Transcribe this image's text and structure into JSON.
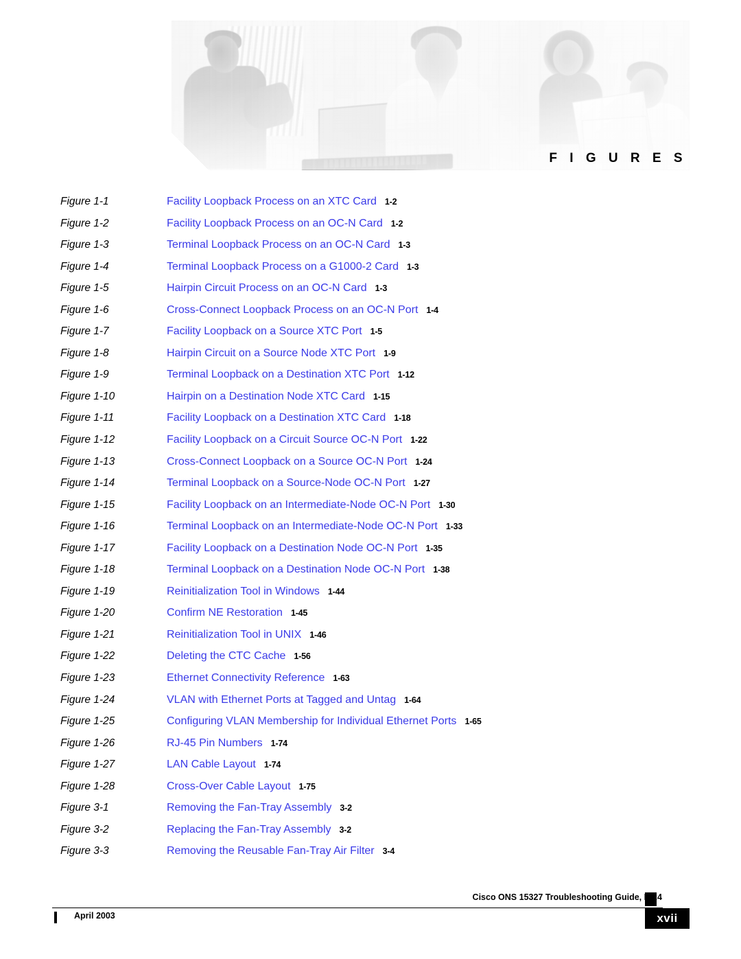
{
  "header": {
    "section_title": "F I G U R E S",
    "banner_icon": "people-collaborating-photo"
  },
  "figure_list": [
    {
      "label": "Figure 1-1",
      "title": "Facility Loopback Process on an XTC Card",
      "page": "1-2"
    },
    {
      "label": "Figure 1-2",
      "title": "Facility Loopback Process on an OC-N Card",
      "page": "1-2"
    },
    {
      "label": "Figure 1-3",
      "title": "Terminal Loopback Process on an OC-N Card",
      "page": "1-3"
    },
    {
      "label": "Figure 1-4",
      "title": "Terminal Loopback Process on a G1000-2 Card",
      "page": "1-3"
    },
    {
      "label": "Figure 1-5",
      "title": "Hairpin Circuit Process on an OC-N Card",
      "page": "1-3"
    },
    {
      "label": "Figure 1-6",
      "title": "Cross-Connect Loopback Process on an OC-N Port",
      "page": "1-4"
    },
    {
      "label": "Figure 1-7",
      "title": "Facility Loopback on a Source XTC Port",
      "page": "1-5"
    },
    {
      "label": "Figure 1-8",
      "title": "Hairpin Circuit on a Source Node XTC Port",
      "page": "1-9"
    },
    {
      "label": "Figure 1-9",
      "title": "Terminal Loopback on a Destination XTC Port",
      "page": "1-12"
    },
    {
      "label": "Figure 1-10",
      "title": "Hairpin on a Destination Node XTC Card",
      "page": "1-15"
    },
    {
      "label": "Figure 1-11",
      "title": "Facility Loopback on a Destination XTC Card",
      "page": "1-18"
    },
    {
      "label": "Figure 1-12",
      "title": "Facility Loopback on a Circuit Source OC-N Port",
      "page": "1-22"
    },
    {
      "label": "Figure 1-13",
      "title": "Cross-Connect Loopback on a Source OC-N Port",
      "page": "1-24"
    },
    {
      "label": "Figure 1-14",
      "title": "Terminal Loopback on a Source-Node OC-N Port",
      "page": "1-27"
    },
    {
      "label": "Figure 1-15",
      "title": "Facility Loopback on an Intermediate-Node OC-N Port",
      "page": "1-30"
    },
    {
      "label": "Figure 1-16",
      "title": "Terminal Loopback on an Intermediate-Node OC-N Port",
      "page": "1-33"
    },
    {
      "label": "Figure 1-17",
      "title": "Facility Loopback on a Destination Node OC-N Port",
      "page": "1-35"
    },
    {
      "label": "Figure 1-18",
      "title": "Terminal Loopback on a Destination Node OC-N Port",
      "page": "1-38"
    },
    {
      "label": "Figure 1-19",
      "title": "Reinitialization Tool in Windows",
      "page": "1-44"
    },
    {
      "label": "Figure 1-20",
      "title": "Confirm NE Restoration",
      "page": "1-45"
    },
    {
      "label": "Figure 1-21",
      "title": "Reinitialization Tool in UNIX",
      "page": "1-46"
    },
    {
      "label": "Figure 1-22",
      "title": "Deleting the CTC Cache",
      "page": "1-56"
    },
    {
      "label": "Figure 1-23",
      "title": "Ethernet Connectivity Reference",
      "page": "1-63"
    },
    {
      "label": "Figure 1-24",
      "title": "VLAN with Ethernet Ports at Tagged and Untag",
      "page": "1-64"
    },
    {
      "label": "Figure 1-25",
      "title": "Configuring VLAN Membership for Individual Ethernet Ports",
      "page": "1-65"
    },
    {
      "label": "Figure 1-26",
      "title": "RJ-45 Pin Numbers",
      "page": "1-74"
    },
    {
      "label": "Figure 1-27",
      "title": "LAN Cable Layout",
      "page": "1-74"
    },
    {
      "label": "Figure 1-28",
      "title": "Cross-Over Cable Layout",
      "page": "1-75"
    },
    {
      "label": "Figure 3-1",
      "title": "Removing the Fan-Tray Assembly",
      "page": "3-2"
    },
    {
      "label": "Figure 3-2",
      "title": "Replacing the Fan-Tray Assembly",
      "page": "3-2"
    },
    {
      "label": "Figure 3-3",
      "title": "Removing the Reusable Fan-Tray Air Filter",
      "page": "3-4"
    }
  ],
  "footer": {
    "guide_title": "Cisco ONS 15327 Troubleshooting Guide, R3.4",
    "date": "April 2003",
    "page_number": "xvii"
  },
  "colors": {
    "link_blue": "#3a3ae8",
    "text_black": "#000000",
    "page_box": "#000000"
  }
}
